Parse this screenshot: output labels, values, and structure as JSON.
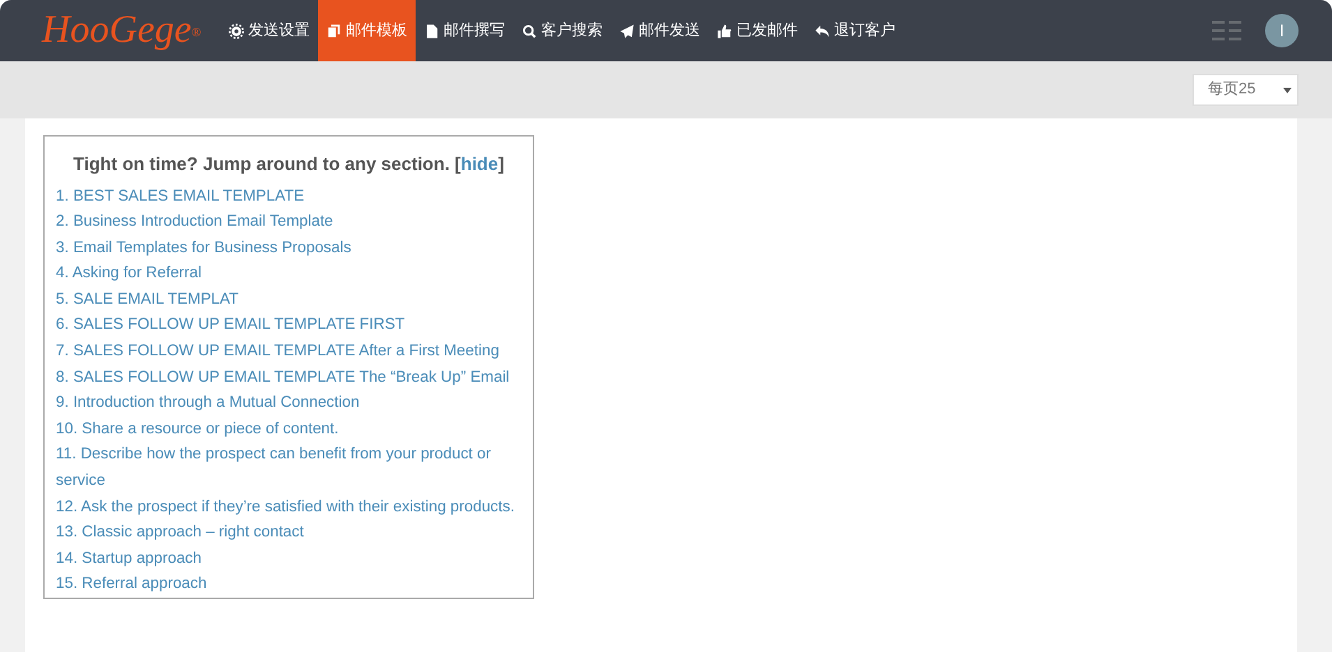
{
  "brand": "HooGege",
  "trademark": "®",
  "nav": [
    {
      "label": "发送设置",
      "selected": false
    },
    {
      "label": "邮件模板",
      "selected": true
    },
    {
      "label": "邮件撰写",
      "selected": false
    },
    {
      "label": "客户搜索",
      "selected": false
    },
    {
      "label": "邮件发送",
      "selected": false
    },
    {
      "label": "已发邮件",
      "selected": false
    },
    {
      "label": "退订客户",
      "selected": false
    }
  ],
  "avatar": "I",
  "page_size": {
    "value": "每页25"
  },
  "toc": {
    "title": "Tight on time? Jump around to any section. [",
    "link": "hide",
    "title_end": "]",
    "items": [
      "1. BEST SALES EMAIL TEMPLATE",
      "2. Business Introduction Email Template",
      "3. Email Templates for Business Proposals",
      "4. Asking for Referral",
      "5. SALE EMAIL TEMPLAT",
      "6. SALES FOLLOW UP EMAIL TEMPLATE FIRST",
      "7. SALES FOLLOW UP EMAIL TEMPLATE After a First Meeting",
      "8. SALES FOLLOW UP EMAIL TEMPLATE The “Break Up” Email",
      "9. Introduction through a Mutual Connection",
      "10. Share a resource or piece of content.",
      "11. Describe how the prospect can benefit from your product or service",
      "12. Ask the prospect if they’re satisfied with their existing products.",
      "13. Classic approach – right contact",
      "14. Startup approach",
      "15. Referral approach"
    ]
  }
}
